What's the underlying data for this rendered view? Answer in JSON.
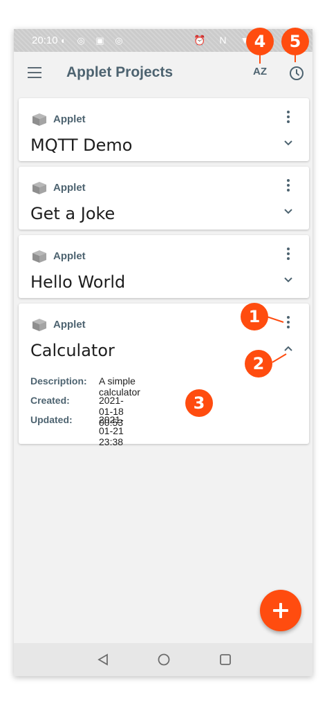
{
  "status_bar": {
    "time": "20:10"
  },
  "app_bar": {
    "title": "Applet Projects",
    "sort_label": "AZ"
  },
  "projects": [
    {
      "type": "Applet",
      "name": "MQTT Demo"
    },
    {
      "type": "Applet",
      "name": "Get a Joke"
    },
    {
      "type": "Applet",
      "name": "Hello World"
    },
    {
      "type": "Applet",
      "name": "Calculator",
      "details": {
        "description_label": "Description:",
        "description": "A simple calculator",
        "created_label": "Created:",
        "created": "2021-01-18 00:53",
        "updated_label": "Updated:",
        "updated": "2021-01-21 23:38"
      }
    }
  ],
  "callouts": [
    "1",
    "2",
    "3",
    "4",
    "5"
  ],
  "colors": {
    "accent": "#ff4c0f",
    "text_secondary": "#4d6370"
  }
}
